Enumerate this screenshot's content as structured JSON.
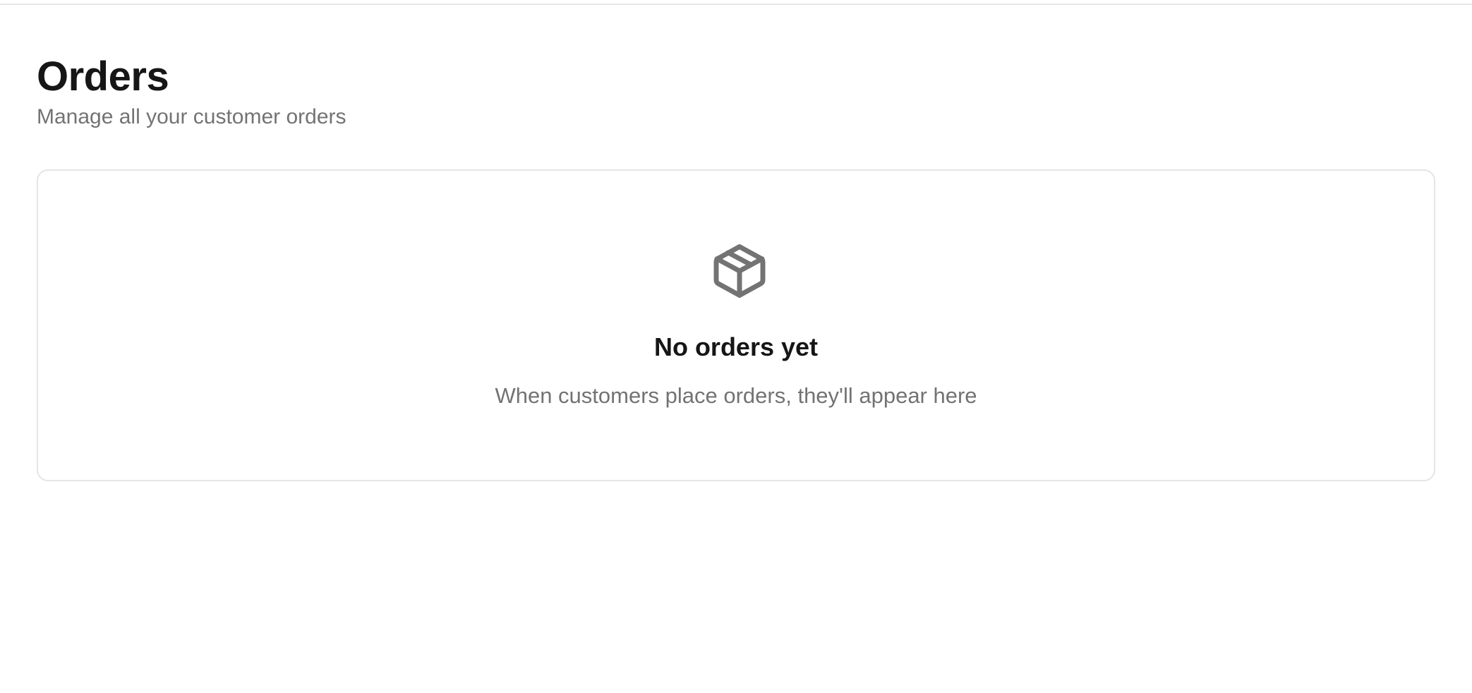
{
  "page": {
    "title": "Orders",
    "subtitle": "Manage all your customer orders"
  },
  "empty_state": {
    "icon": "package-icon",
    "title": "No orders yet",
    "description": "When customers place orders, they'll appear here"
  },
  "colors": {
    "title_text": "#161616",
    "muted_text": "#737373",
    "icon": "#737373",
    "card_border": "#e5e5e5",
    "background": "#ffffff"
  }
}
